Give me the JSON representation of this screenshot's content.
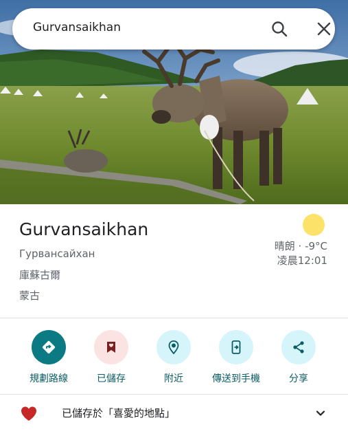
{
  "search": {
    "query": "Gurvansaikhan"
  },
  "place": {
    "name": "Gurvansaikhan",
    "native_name": "Гурвансайхан",
    "region": "庫蘇古爾",
    "country": "蒙古"
  },
  "weather": {
    "condition": "晴朗 · -9°C",
    "time": "凌晨12:01"
  },
  "actions": [
    {
      "label": "規劃路線",
      "icon": "directions-icon",
      "bg": "#0b7a82",
      "fg": "#ffffff"
    },
    {
      "label": "已儲存",
      "icon": "bookmark-icon",
      "bg": "#fbe3e3",
      "fg": "#7a1f1f"
    },
    {
      "label": "附近",
      "icon": "nearby-icon",
      "bg": "#d6f5fa",
      "fg": "#0b5c63"
    },
    {
      "label": "傳送到手機",
      "icon": "send-to-phone-icon",
      "bg": "#d6f5fa",
      "fg": "#0b5c63"
    },
    {
      "label": "分享",
      "icon": "share-icon",
      "bg": "#d6f5fa",
      "fg": "#0b5c63"
    }
  ],
  "saved": {
    "text": "已儲存於「喜愛的地點」",
    "icon": "heart-icon",
    "color": "#c62828"
  }
}
